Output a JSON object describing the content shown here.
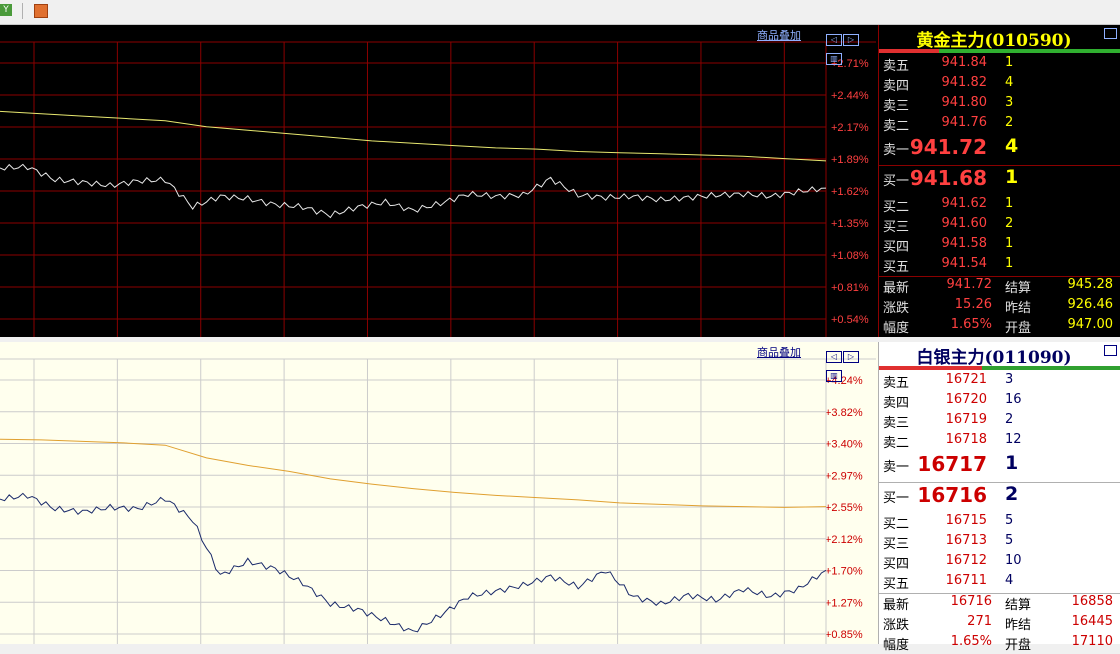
{
  "app": {
    "toolbar": {
      "btn1_icon": "y-icon",
      "btn1_text": "Y",
      "btn2_icon": "grid-icon"
    }
  },
  "panels": [
    {
      "id": "gold",
      "theme": {
        "bg": "#000000",
        "grid": "#8b0000",
        "axis_text": "#ff4040",
        "ma_line": "#e8e870",
        "price_line": "#e8e8e8",
        "title_color": "#ffff00",
        "label_color": "#e0e0e0",
        "price_color": "#ff4040",
        "vol_color": "#ffff00"
      },
      "overlay_label": "商品叠加",
      "title": "黄金主力(010590)",
      "chart_data": {
        "type": "line",
        "y_tick_labels": [
          "+2.71%",
          "+2.44%",
          "+2.17%",
          "+1.89%",
          "+1.62%",
          "+1.35%",
          "+1.08%",
          "+0.81%",
          "+0.54%"
        ],
        "ylim_pct": [
          0.54,
          2.71
        ],
        "series": [
          {
            "role": "avg",
            "values": [
              2.3,
              2.28,
              2.26,
              2.24,
              2.22,
              2.17,
              2.14,
              2.11,
              2.08,
              2.05,
              2.03,
              2.01,
              1.99,
              1.98,
              1.96,
              1.95,
              1.94,
              1.93,
              1.92,
              1.9,
              1.88
            ]
          },
          {
            "role": "price",
            "values": [
              1.82,
              1.83,
              1.72,
              1.7,
              1.67,
              1.71,
              1.72,
              1.49,
              1.58,
              1.56,
              1.51,
              1.49,
              1.42,
              1.49,
              1.53,
              1.46,
              1.52,
              1.6,
              1.58,
              1.59,
              1.73,
              1.59,
              1.57,
              1.58,
              1.55,
              1.57,
              1.59,
              1.6,
              1.58,
              1.62,
              1.65
            ]
          }
        ]
      },
      "quote": {
        "asks": [
          {
            "label": "卖五",
            "price": "941.84",
            "vol": "1"
          },
          {
            "label": "卖四",
            "price": "941.82",
            "vol": "4"
          },
          {
            "label": "卖三",
            "price": "941.80",
            "vol": "3"
          },
          {
            "label": "卖二",
            "price": "941.76",
            "vol": "2"
          }
        ],
        "ask1": {
          "label": "卖一",
          "price": "941.72",
          "vol": "4"
        },
        "bid1": {
          "label": "买一",
          "price": "941.68",
          "vol": "1"
        },
        "bids": [
          {
            "label": "买二",
            "price": "941.62",
            "vol": "1"
          },
          {
            "label": "买三",
            "price": "941.60",
            "vol": "2"
          },
          {
            "label": "买四",
            "price": "941.58",
            "vol": "1"
          },
          {
            "label": "买五",
            "price": "941.54",
            "vol": "1"
          }
        ],
        "stats": [
          {
            "l1": "最新",
            "v1": "941.72",
            "l2": "结算",
            "v2": "945.28"
          },
          {
            "l1": "涨跌",
            "v1": "15.26",
            "l2": "昨结",
            "v2": "926.46"
          },
          {
            "l1": "幅度",
            "v1": "1.65%",
            "l2": "开盘",
            "v2": "947.00"
          }
        ]
      }
    },
    {
      "id": "silver",
      "theme": {
        "bg": "#ffffee",
        "grid": "#cccccc",
        "axis_text": "#cc0000",
        "ma_line": "#e0a030",
        "price_line": "#1a2a6a",
        "title_color": "#000060",
        "label_color": "#000000",
        "price_color": "#cc0000",
        "vol_color": "#000060"
      },
      "overlay_label": "商品叠加",
      "title": "白银主力(011090)",
      "chart_data": {
        "type": "line",
        "y_tick_labels": [
          "+4.24%",
          "+3.82%",
          "+3.40%",
          "+2.97%",
          "+2.55%",
          "+2.12%",
          "+1.70%",
          "+1.27%",
          "+0.85%"
        ],
        "ylim_pct": [
          0.85,
          4.24
        ],
        "series": [
          {
            "role": "avg",
            "values": [
              3.45,
              3.44,
              3.42,
              3.4,
              3.37,
              3.2,
              3.1,
              3.02,
              2.92,
              2.85,
              2.79,
              2.74,
              2.7,
              2.67,
              2.64,
              2.6,
              2.58,
              2.56,
              2.55,
              2.54,
              2.55
            ]
          },
          {
            "role": "price",
            "values": [
              2.65,
              2.7,
              2.52,
              2.48,
              2.54,
              2.52,
              2.66,
              2.37,
              1.63,
              1.82,
              1.72,
              1.53,
              1.25,
              1.18,
              1.03,
              0.88,
              1.1,
              1.35,
              1.42,
              1.5,
              1.62,
              1.48,
              1.7,
              1.35,
              1.25,
              1.37,
              1.3,
              1.45,
              1.35,
              1.45,
              1.7
            ]
          }
        ]
      },
      "quote": {
        "asks": [
          {
            "label": "卖五",
            "price": "16721",
            "vol": "3"
          },
          {
            "label": "卖四",
            "price": "16720",
            "vol": "16"
          },
          {
            "label": "卖三",
            "price": "16719",
            "vol": "2"
          },
          {
            "label": "卖二",
            "price": "16718",
            "vol": "12"
          }
        ],
        "ask1": {
          "label": "卖一",
          "price": "16717",
          "vol": "1"
        },
        "bid1": {
          "label": "买一",
          "price": "16716",
          "vol": "2"
        },
        "bids": [
          {
            "label": "买二",
            "price": "16715",
            "vol": "5"
          },
          {
            "label": "买三",
            "price": "16713",
            "vol": "5"
          },
          {
            "label": "买四",
            "price": "16712",
            "vol": "10"
          },
          {
            "label": "买五",
            "price": "16711",
            "vol": "4"
          }
        ],
        "stats": [
          {
            "l1": "最新",
            "v1": "16716",
            "l2": "结算",
            "v2": "16858"
          },
          {
            "l1": "涨跌",
            "v1": "271",
            "l2": "昨结",
            "v2": "16445"
          },
          {
            "l1": "幅度",
            "v1": "1.65%",
            "l2": "开盘",
            "v2": "17110"
          }
        ]
      }
    }
  ]
}
